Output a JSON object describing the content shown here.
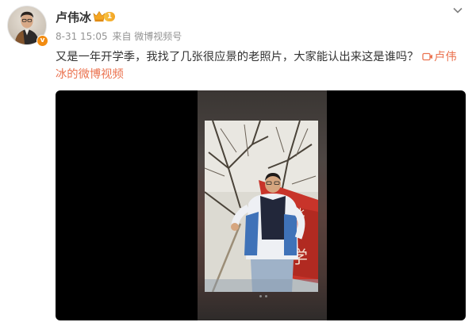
{
  "post": {
    "author": "卢伟冰",
    "vip_level": "1",
    "timestamp": "8-31 15:05",
    "source": "来自 微博视频号",
    "text": "又是一年开学季，我找了几张很应景的老照片，大家能认出来这是谁吗？",
    "video_link_label": "卢伟冰的微博视频"
  },
  "icons": {
    "verified": "verified-v-icon",
    "vip": "crown-icon",
    "menu": "chevron-down-icon",
    "video": "video-camera-icon"
  },
  "colors": {
    "link": "#eb7350",
    "verified": "#f28b10",
    "meta": "#939393"
  }
}
